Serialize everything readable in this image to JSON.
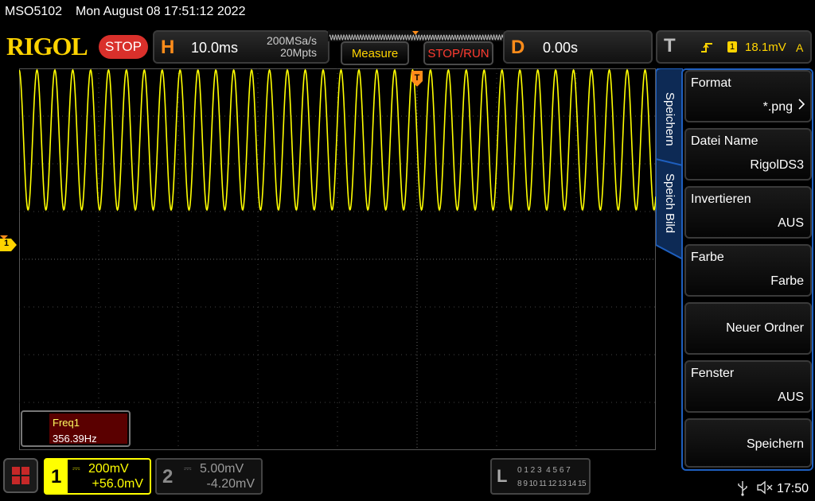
{
  "status_bar": {
    "model": "MSO5102",
    "datetime": "Mon August 08 17:51:12 2022"
  },
  "header": {
    "brand": "RIGOL",
    "run_state": "STOP",
    "horizontal": {
      "letter": "H",
      "timebase": "10.0ms",
      "sample_rate": "200MSa/s",
      "memory_depth": "20Mpts"
    },
    "measure_label": "Measure",
    "stop_run_label": "STOP/RUN",
    "delay": {
      "letter": "D",
      "value": "0.00s"
    },
    "trigger": {
      "letter": "T",
      "channel": "1",
      "level": "18.1mV",
      "mode": "A"
    }
  },
  "side_tabs": [
    "Speichern",
    "Speich Bild"
  ],
  "menu": [
    {
      "title": "Format",
      "value": "*.png",
      "has_chevron": true
    },
    {
      "title": "Datei Name",
      "value": "RigolDS3"
    },
    {
      "title": "Invertieren",
      "value": "AUS"
    },
    {
      "title": "Farbe",
      "value": "Farbe"
    },
    {
      "title": "",
      "value": "Neuer Ordner"
    },
    {
      "title": "Fenster",
      "value": "AUS"
    },
    {
      "title": "",
      "value": "Speichern"
    }
  ],
  "channel_marker": "1",
  "measurement": {
    "label": "Freq1",
    "value": "356.39Hz"
  },
  "channels": [
    {
      "num": "1",
      "scale": "200mV",
      "offset": "+56.0mV",
      "color": "#ffff00",
      "active": true
    },
    {
      "num": "2",
      "scale": "5.00mV",
      "offset": "-4.20mV",
      "color": "#9a9a9a",
      "active": false
    }
  ],
  "logic": {
    "letter": "L",
    "row1": "0 1 2 3  4 5 6 7",
    "row2": "8 9 10 11 12 13 14 15"
  },
  "system_tray": {
    "time": "17:50"
  },
  "colors": {
    "ch1": "#ffff00",
    "accent": "#ff8c1a",
    "stop": "#d9302b",
    "menu_border": "#1e5fbf"
  },
  "waveform": {
    "frequency_hz": 356.39,
    "cycles_visible": 35.6
  }
}
